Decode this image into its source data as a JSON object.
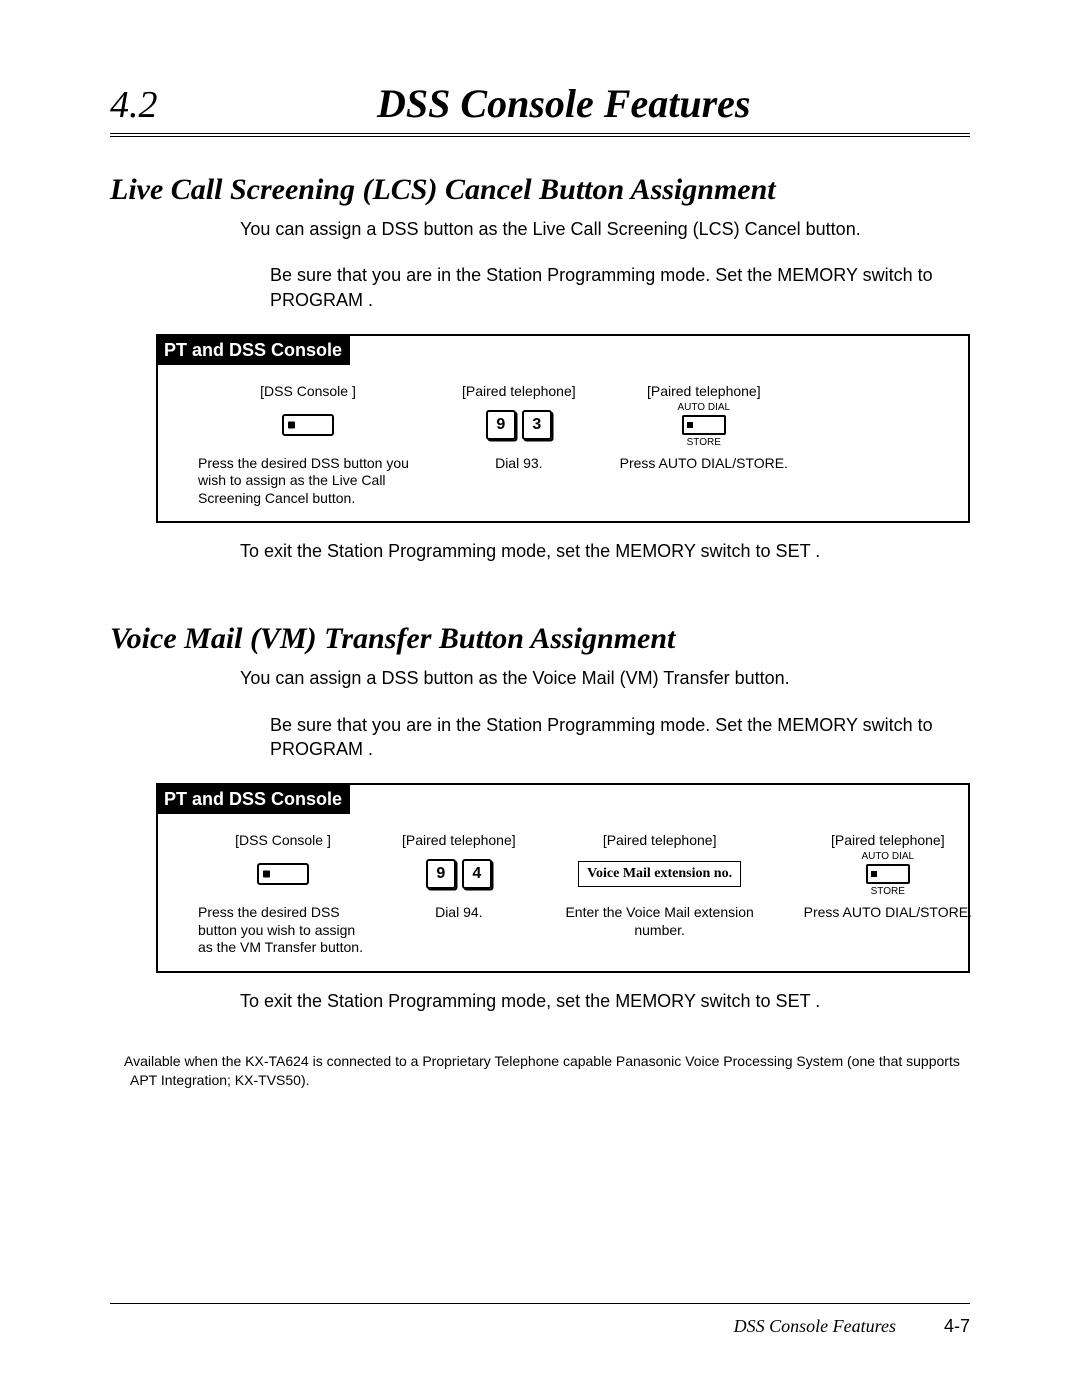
{
  "chapter": {
    "number": "4.2",
    "title": "DSS Console Features"
  },
  "section1": {
    "title": "Live Call Screening (LCS) Cancel Button Assignment",
    "intro": "You can assign a DSS button as the Live Call Screening (LCS) Cancel button.",
    "note": "Be sure that you are in the Station Programming mode. Set the MEMORY switch to PROGRAM .",
    "box_header": "PT and DSS Console",
    "steps": [
      {
        "label": "[DSS Console ]",
        "icon": "dss-button",
        "desc": "Press the desired DSS button you wish to assign as the Live Call Screening Cancel button."
      },
      {
        "label": "[Paired telephone]",
        "icon": "digits",
        "digits": [
          "9",
          "3"
        ],
        "desc": "Dial 93."
      },
      {
        "label": "[Paired telephone]",
        "icon": "autodial",
        "top": "AUTO DIAL",
        "bottom": "STORE",
        "desc": "Press AUTO DIAL/STORE."
      }
    ],
    "exit": "To exit the Station Programming mode, set the MEMORY switch to  SET ."
  },
  "section2": {
    "title": "Voice Mail (VM) Transfer Button Assignment",
    "intro": "You can assign a DSS button as the Voice Mail (VM) Transfer button.",
    "note": "Be sure that you are in the Station Programming mode. Set the MEMORY switch to PROGRAM .",
    "box_header": "PT and DSS Console",
    "steps": [
      {
        "label": "[DSS Console ]",
        "icon": "dss-button",
        "desc": "Press the desired DSS button you wish to assign as the VM Transfer button."
      },
      {
        "label": "[Paired telephone]",
        "icon": "digits",
        "digits": [
          "9",
          "4"
        ],
        "desc": "Dial 94."
      },
      {
        "label": "[Paired telephone]",
        "icon": "vm-ext",
        "box_text": "Voice Mail extension no.",
        "desc": "Enter the Voice Mail extension number."
      },
      {
        "label": "[Paired telephone]",
        "icon": "autodial",
        "top": "AUTO DIAL",
        "bottom": "STORE",
        "desc": "Press AUTO DIAL/STORE."
      }
    ],
    "exit": "To exit the Station Programming mode, set the MEMORY switch to  SET ."
  },
  "footnote": "Available when the KX-TA624 is connected to a Proprietary Telephone capable Panasonic Voice Processing System (one that supports APT Integration; KX-TVS50).",
  "footer": {
    "title": "DSS Console Features",
    "page": "4-7"
  }
}
